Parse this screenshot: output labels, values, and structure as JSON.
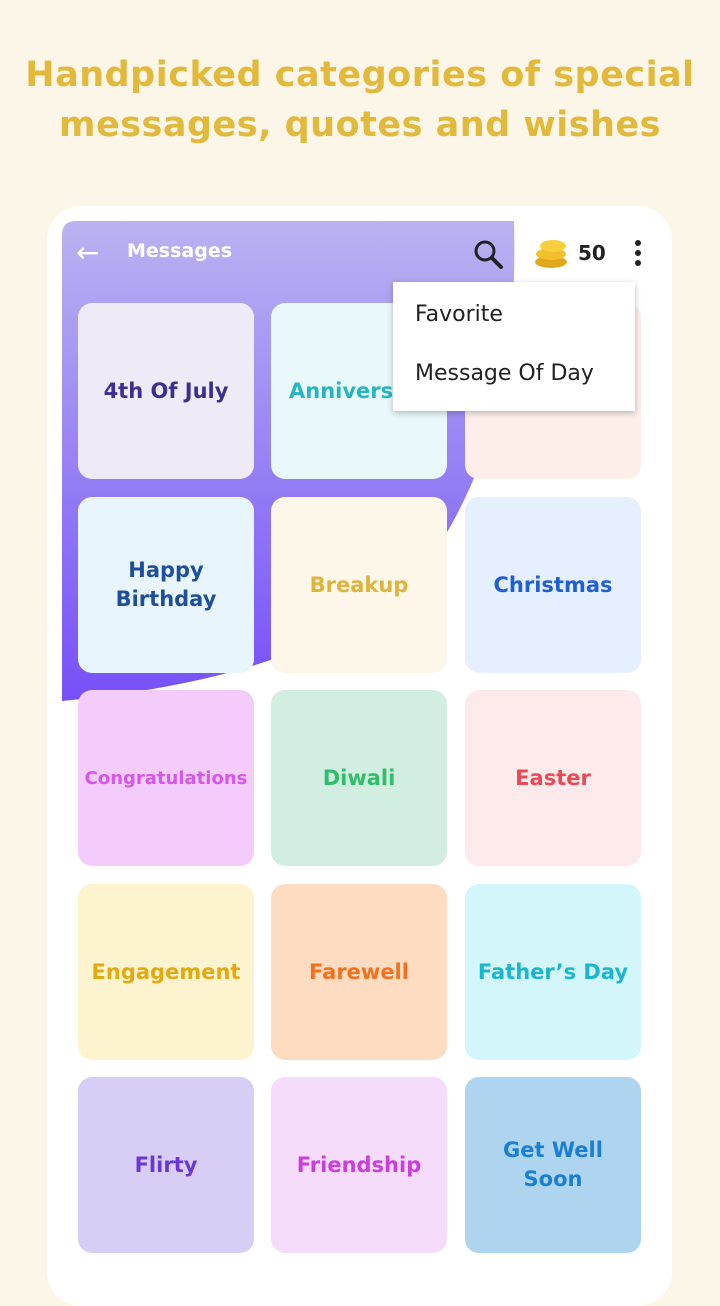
{
  "headline": "Handpicked categories of special messages, quotes and wishes",
  "header": {
    "title": "Messages",
    "coins": "50",
    "icons": [
      "back-arrow-icon",
      "search-icon",
      "coins-icon",
      "more-vert-icon"
    ]
  },
  "menu": {
    "items": [
      "Favorite",
      "Message Of Day"
    ]
  },
  "accent": "#7b5cf5",
  "categories": [
    {
      "label": "4th Of July",
      "bg": "#eeebf7",
      "fg": "#3b2f8f"
    },
    {
      "label": "Anniversary",
      "bg": "#e8f8fb",
      "fg": "#27b5c4"
    },
    {
      "label": "",
      "bg": "#fdeee9",
      "fg": "#e06050"
    },
    {
      "label": "Happy Birthday",
      "bg": "#e9f5fd",
      "fg": "#1d4f9a"
    },
    {
      "label": "Breakup",
      "bg": "#fdf7ea",
      "fg": "#e0b33c"
    },
    {
      "label": "Christmas",
      "bg": "#e6effd",
      "fg": "#1f5fd6"
    },
    {
      "label": "Congratulations",
      "bg": "#f3ccfb",
      "fg": "#d457e8"
    },
    {
      "label": "Diwali",
      "bg": "#d2eee0",
      "fg": "#2fbf6a"
    },
    {
      "label": "Easter",
      "bg": "#fdebeb",
      "fg": "#e84a57"
    },
    {
      "label": "Engagement",
      "bg": "#fdf3cf",
      "fg": "#e0aa10"
    },
    {
      "label": "Farewell",
      "bg": "#fddcc2",
      "fg": "#f0721e"
    },
    {
      "label": "Father’s Day",
      "bg": "#d3f6fb",
      "fg": "#1cb5cf"
    },
    {
      "label": "Flirty",
      "bg": "#d8cdf5",
      "fg": "#6a36d8"
    },
    {
      "label": "Friendship",
      "bg": "#f5dcfa",
      "fg": "#cc3de0"
    },
    {
      "label": "Get Well Soon",
      "bg": "#aed4f0",
      "fg": "#1a7fd0"
    }
  ]
}
